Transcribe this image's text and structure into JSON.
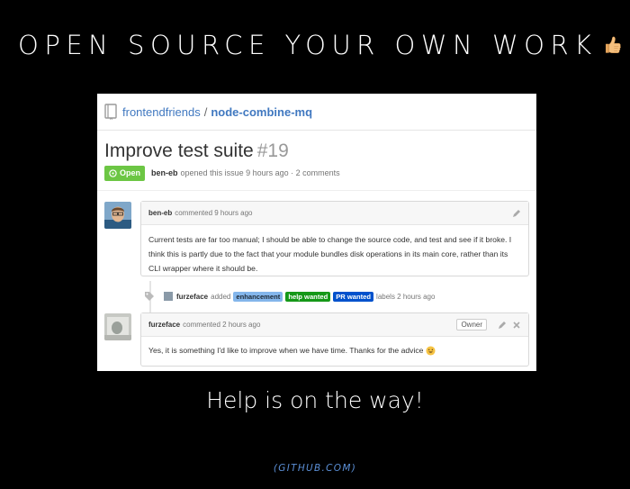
{
  "slide": {
    "title": "OPEN SOURCE YOUR OWN WORK",
    "caption": "Help is on the way!",
    "source": "(GITHUB.COM)"
  },
  "repo": {
    "owner": "frontendfriends",
    "separator": "/",
    "name": "node-combine-mq"
  },
  "issue": {
    "title": "Improve test suite",
    "number": "#19",
    "state": "Open",
    "author": "ben-eb",
    "meta": "opened this issue 9 hours ago · 2 comments"
  },
  "comments": [
    {
      "author": "ben-eb",
      "meta": "commented 9 hours ago",
      "body": "Current tests are far too manual; I should be able to change the source code, and test and see if it broke. I think this is partly due to the fact that your module bundles disk operations in its main core, rather than its CLI wrapper where it should be."
    },
    {
      "author": "furzeface",
      "meta": "commented 2 hours ago",
      "badge": "Owner",
      "body": "Yes, it is something I'd like to improve when we have time. Thanks for the advice"
    }
  ],
  "label_event": {
    "actor": "furzeface",
    "action": "added",
    "labels": [
      "enhancement",
      "help wanted",
      "PR wanted"
    ],
    "suffix": "labels 2 hours ago"
  },
  "colors": {
    "background": "#000000",
    "link_blue": "#4078c0",
    "open_green": "#6cc644",
    "label_enhancement": "#84b6eb",
    "label_help_wanted": "#159818",
    "label_pr_wanted": "#0052cc",
    "source_blue": "#5b8fd6"
  },
  "icons": [
    "thumbs-up-icon",
    "repo-book-icon",
    "issue-opened-icon",
    "pencil-icon",
    "tag-icon",
    "close-icon",
    "smile-emoji-icon"
  ]
}
